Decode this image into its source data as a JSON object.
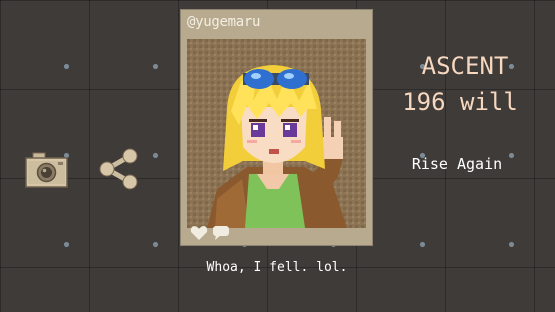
{
  "post": {
    "handle": "@yugemaru",
    "caption": "Whoa, I fell. lol.",
    "icons": [
      "heart-icon",
      "comment-icon"
    ]
  },
  "status": {
    "title": "ASCENT",
    "will_value": "196",
    "will_label": "will",
    "action_label": "Rise Again"
  },
  "buttons": {
    "camera": "camera-icon",
    "share": "share-icon"
  },
  "colors": {
    "background": "#3f3b39",
    "grid_dot": "#7c8a96",
    "card": "#b7aa8f",
    "title_text": "#f6d7bf"
  }
}
